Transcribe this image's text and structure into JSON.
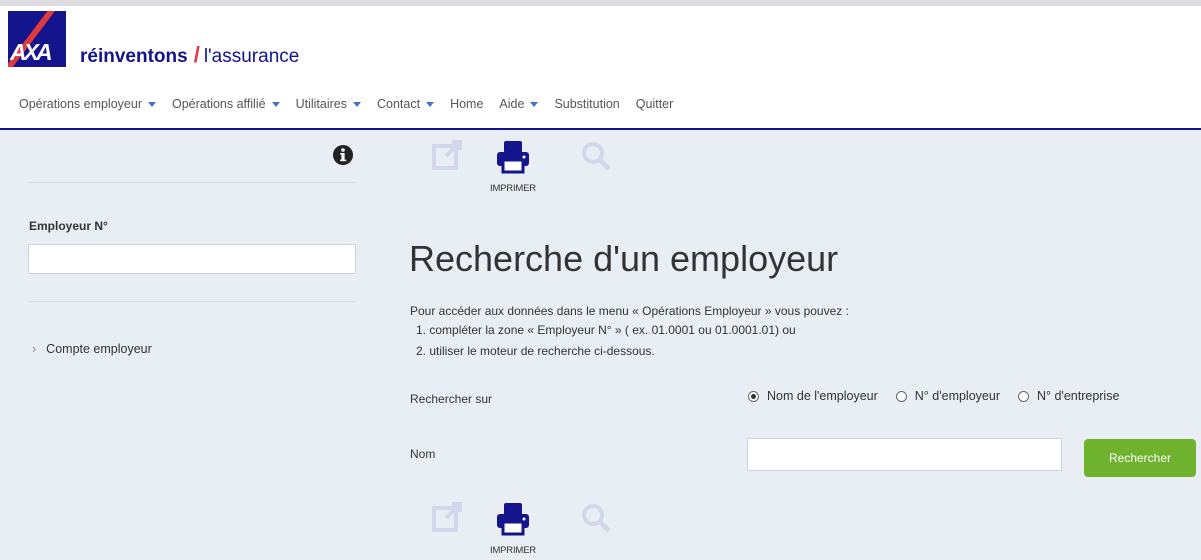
{
  "brand": {
    "logo_text": "AXA",
    "slogan_bold": "réinventons",
    "slogan_rest": "l'assurance"
  },
  "nav": [
    {
      "label": "Opérations employeur",
      "dropdown": true
    },
    {
      "label": "Opérations affilié",
      "dropdown": true
    },
    {
      "label": "Utilitaires",
      "dropdown": true
    },
    {
      "label": "Contact",
      "dropdown": true
    },
    {
      "label": "Home",
      "dropdown": false
    },
    {
      "label": "Aide",
      "dropdown": true
    },
    {
      "label": "Substitution",
      "dropdown": false
    },
    {
      "label": "Quitter",
      "dropdown": false
    }
  ],
  "sidebar": {
    "info_icon": "info-circle-icon",
    "employer_label": "Employeur N°",
    "employer_value": "",
    "link_label": "Compte employeur"
  },
  "toolbar": {
    "print_label": "IMPRIMER"
  },
  "main": {
    "title": "Recherche d'un employeur",
    "intro": "Pour accéder aux données dans le menu « Opérations Employeur » vous pouvez :",
    "steps": [
      "compléter la zone « Employeur N° » ( ex. 01.0001 ou 01.0001.01) ou",
      "utiliser le moteur de recherche ci-dessous."
    ],
    "search_on_label": "Rechercher sur",
    "radio_options": [
      {
        "label": "Nom de l'employeur",
        "selected": true
      },
      {
        "label": "N° d'employeur",
        "selected": false
      },
      {
        "label": "N° d'entreprise",
        "selected": false
      }
    ],
    "name_label": "Nom",
    "name_value": "",
    "search_button": "Rechercher"
  },
  "colors": {
    "brand_blue": "#14148c",
    "brand_red": "#e03a3e",
    "button_green": "#6fb22e",
    "background": "#e9eef4"
  }
}
